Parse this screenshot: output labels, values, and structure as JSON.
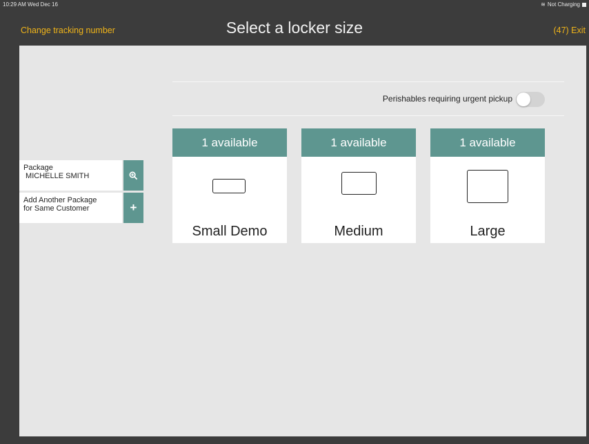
{
  "status_bar": {
    "time": "10:29 AM  Wed Dec 16",
    "charging": "Not Charging"
  },
  "nav": {
    "left_label": "Change tracking number",
    "title": "Select a locker size",
    "right_label": "(47) Exit"
  },
  "perishables": {
    "label": "Perishables requiring urgent pickup",
    "enabled": false
  },
  "packages": [
    {
      "line1": "Package",
      "line2": " MICHELLE SMITH",
      "icon": "zoom-in-icon"
    },
    {
      "line1": "Add Another Package",
      "line2": "for Same Customer",
      "icon": "plus-icon"
    }
  ],
  "lockers": [
    {
      "availability": "1 available",
      "name": "Small Demo"
    },
    {
      "availability": "1 available",
      "name": "Medium"
    },
    {
      "availability": "1 available",
      "name": "Large"
    }
  ],
  "colors": {
    "accent": "#5e9690",
    "nav_link": "#f0b419",
    "background": "#e6e6e6"
  }
}
